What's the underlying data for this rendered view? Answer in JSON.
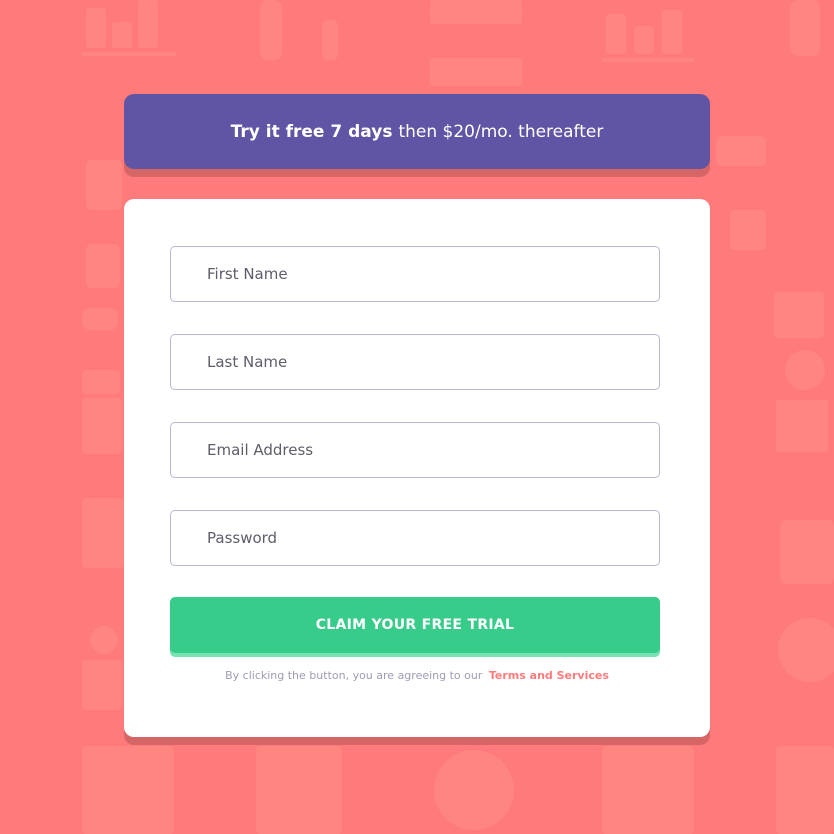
{
  "colors": {
    "background": "#ff7a7a",
    "banner": "#6055a5",
    "button": "#38cc8b",
    "button_shadow": "#77e2b3",
    "link": "#ff7a7a",
    "muted_text": "#9f9bb4",
    "input_border": "#b9b6d3"
  },
  "banner": {
    "highlight": "Try it free 7 days",
    "rest": "then $20/mo. thereafter"
  },
  "form": {
    "first_name": {
      "placeholder": "First Name",
      "value": ""
    },
    "last_name": {
      "placeholder": "Last Name",
      "value": ""
    },
    "email": {
      "placeholder": "Email Address",
      "value": ""
    },
    "password": {
      "placeholder": "Password",
      "value": ""
    },
    "submit_label": "CLAIM YOUR FREE TRIAL",
    "terms_text": "By clicking the button, you are agreeing to our",
    "terms_link": "Terms and Services"
  }
}
